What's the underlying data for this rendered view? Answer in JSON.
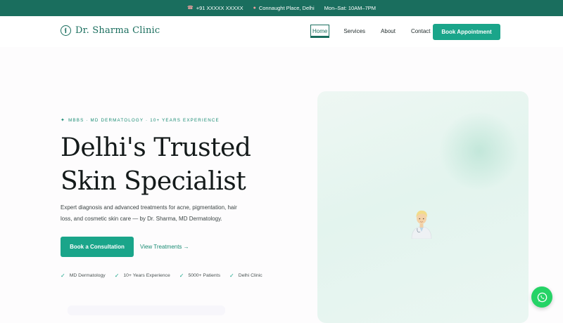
{
  "topbar": {
    "phone": "+91 XXXXX XXXXX",
    "location": "Connaught Place, Delhi",
    "hours": "Mon–Sat: 10AM–7PM",
    "phone_icon": "phone-icon",
    "location_icon": "map-pin-icon"
  },
  "nav": {
    "brand": "Dr. Sharma Clinic",
    "links": [
      "Home",
      "Services",
      "About",
      "Contact"
    ],
    "active": "Home",
    "cta": "Book Appointment"
  },
  "hero": {
    "eyebrow": "MBBS · MD DERMATOLOGY · 10+ YEARS EXPERIENCE",
    "headline_line1": "Delhi's Trusted",
    "headline_line2": "Skin Specialist",
    "subcopy": "Expert diagnosis and advanced treatments for acne, pigmentation, hair loss, and cosmetic skin care — by Dr. Sharma, MD Dermatology.",
    "primary_cta": "Book a Consultation",
    "secondary_cta": "View Treatments →",
    "badges": [
      "MD Dermatology",
      "10+ Years Experience",
      "5000+ Patients",
      "Delhi Clinic"
    ]
  },
  "colors": {
    "brand": "#1a6e5e",
    "accent": "#1aa58a",
    "whatsapp": "#25d366"
  }
}
